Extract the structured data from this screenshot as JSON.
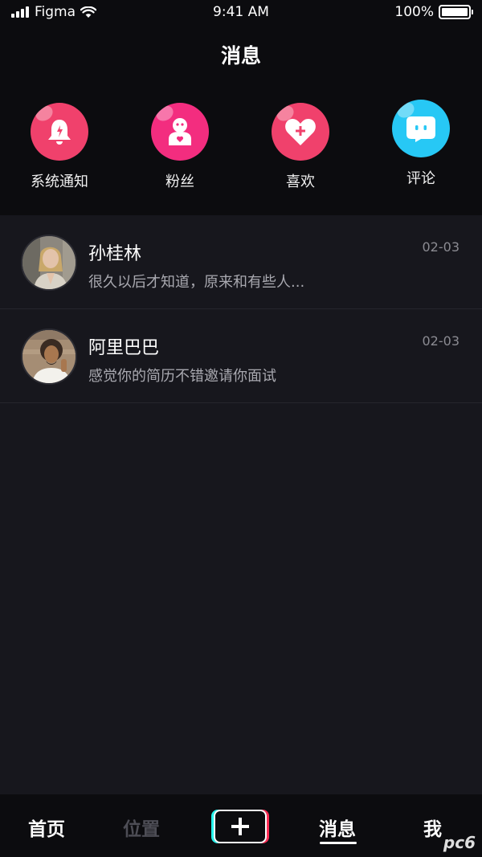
{
  "status_bar": {
    "carrier": "Figma",
    "time": "9:41 AM",
    "battery": "100%"
  },
  "header": {
    "title": "消息"
  },
  "categories": [
    {
      "label": "系统通知",
      "icon": "bell-icon",
      "color": "#f0416c"
    },
    {
      "label": "粉丝",
      "icon": "fan-robot-icon",
      "color": "#f32d7f"
    },
    {
      "label": "喜欢",
      "icon": "heart-plus-icon",
      "color": "#f0416c"
    },
    {
      "label": "评论",
      "icon": "comment-icon",
      "color": "#27c8f5"
    }
  ],
  "messages": [
    {
      "name": "孙桂林",
      "preview": "很久以后才知道，原来和有些人...",
      "date": "02-03"
    },
    {
      "name": "阿里巴巴",
      "preview": "感觉你的简历不错邀请你面试",
      "date": "02-03"
    }
  ],
  "tabbar": {
    "home": "首页",
    "location": "位置",
    "add": "plus-icon",
    "messages": "消息",
    "me": "我",
    "active": "消息"
  },
  "watermark": "pc6"
}
